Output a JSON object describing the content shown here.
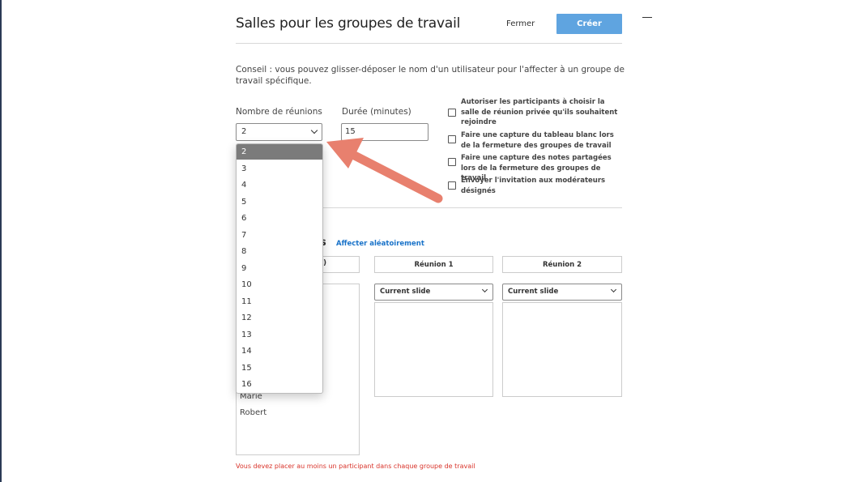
{
  "dialog": {
    "title": "Salles pour les groupes de travail",
    "close_label": "Fermer",
    "create_label": "Créer",
    "hint": "Conseil : vous pouvez glisser-déposer le nom d'un utilisateur pour l'affecter à un groupe de travail spécifique."
  },
  "form": {
    "rooms_label": "Nombre de réunions",
    "rooms_value": "2",
    "duration_label": "Durée (minutes)",
    "duration_value": "15"
  },
  "options": [
    {
      "label": "Autoriser les participants à choisir la salle de réunion privée qu'ils souhaitent rejoindre",
      "checked": false
    },
    {
      "label": "Faire une capture du tableau blanc lors de la fermeture des groupes de travail",
      "checked": false
    },
    {
      "label": "Faire une capture des notes partagées lors de la fermeture des groupes de travail",
      "checked": false
    },
    {
      "label": "Envoyer l'invitation aux modérateurs désignés",
      "checked": false
    }
  ],
  "assign": {
    "title_fragment": "s",
    "random_link": "Affecter aléatoirement",
    "unassigned_header_fragment": ")",
    "rooms": [
      {
        "name": "Réunion 1",
        "slide": "Current slide"
      },
      {
        "name": "Réunion 2",
        "slide": "Current slide"
      }
    ],
    "unassigned_people": [
      "Marie",
      "Robert"
    ]
  },
  "dropdown": {
    "selected": "2",
    "options": [
      "2",
      "3",
      "4",
      "5",
      "6",
      "7",
      "8",
      "9",
      "10",
      "11",
      "12",
      "13",
      "14",
      "15",
      "16"
    ]
  },
  "error_message": "Vous devez placer au moins un participant dans chaque groupe de travail",
  "colors": {
    "accent": "#5fa4e0",
    "link": "#1a73c9",
    "error": "#d9342b",
    "arrow": "#e8806e",
    "selected_option": "#7b7b7b"
  }
}
